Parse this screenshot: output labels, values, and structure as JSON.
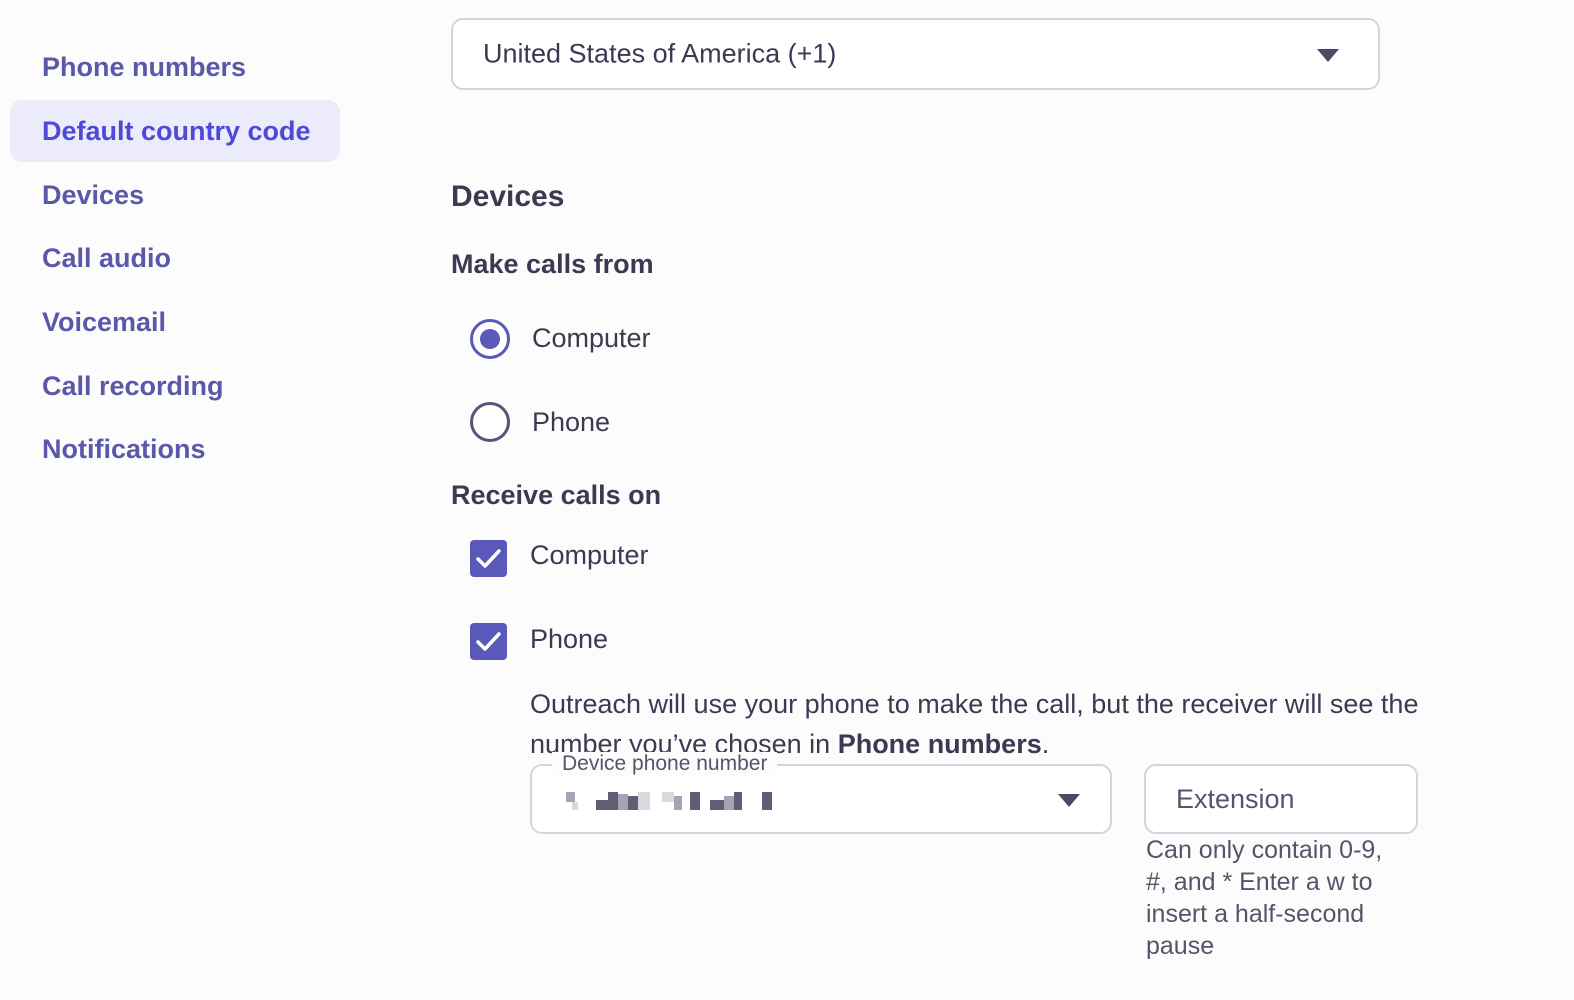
{
  "sidebar": {
    "items": [
      {
        "label": "Phone numbers"
      },
      {
        "label": "Default country code",
        "active": true
      },
      {
        "label": "Devices"
      },
      {
        "label": "Call audio"
      },
      {
        "label": "Voicemail"
      },
      {
        "label": "Call recording"
      },
      {
        "label": "Notifications"
      }
    ]
  },
  "country_code": {
    "selected": "United States of America (+1)"
  },
  "devices": {
    "title": "Devices",
    "make_calls_from": {
      "label": "Make calls from",
      "options": [
        {
          "label": "Computer",
          "selected": true
        },
        {
          "label": "Phone",
          "selected": false
        }
      ]
    },
    "receive_calls_on": {
      "label": "Receive calls on",
      "options": [
        {
          "label": "Computer",
          "checked": true
        },
        {
          "label": "Phone",
          "checked": true
        }
      ]
    },
    "phone_help": {
      "text_before": "Outreach will use your phone to make the call, but the receiver will see the number you’ve chosen in ",
      "link": "Phone numbers",
      "text_after": "."
    },
    "device_phone_number": {
      "label": "Device phone number"
    },
    "extension": {
      "placeholder": "Extension",
      "hint": "Can only contain 0-9, #, and * Enter a w to insert a half-second pause"
    }
  },
  "colors": {
    "accent": "#5a58b8",
    "nav_text": "#5a58a8",
    "nav_active_text": "#4e49d6",
    "nav_active_bg": "#ecebfb",
    "text": "#3b3a52"
  }
}
